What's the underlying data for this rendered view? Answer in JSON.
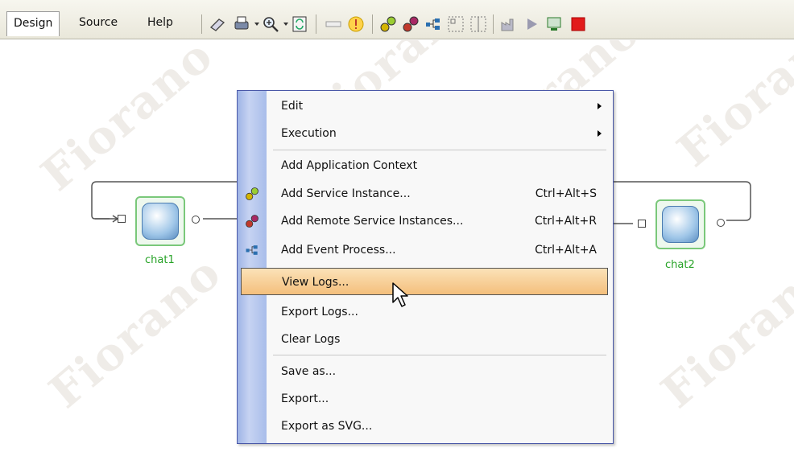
{
  "toolbar": {
    "tabs": [
      "Design",
      "Source",
      "Help"
    ],
    "active_tab": "Design"
  },
  "canvas": {
    "watermark": "Fiorano",
    "nodes": [
      {
        "label": "chat1"
      },
      {
        "label": "chat2"
      }
    ]
  },
  "context_menu": {
    "items": [
      {
        "label": "Edit",
        "submenu": true
      },
      {
        "label": "Execution",
        "submenu": true
      },
      {
        "label": "Add Application Context"
      },
      {
        "label": "Add Service Instance...",
        "shortcut": "Ctrl+Alt+S",
        "icon": "service-instance-icon"
      },
      {
        "label": "Add Remote Service Instances...",
        "shortcut": "Ctrl+Alt+R",
        "icon": "remote-service-icon"
      },
      {
        "label": "Add Event Process...",
        "shortcut": "Ctrl+Alt+A",
        "icon": "event-process-icon"
      },
      {
        "label": "View Logs...",
        "highlighted": true
      },
      {
        "label": "Export Logs..."
      },
      {
        "label": "Clear Logs"
      },
      {
        "label": "Save as..."
      },
      {
        "label": "Export..."
      },
      {
        "label": "Export as SVG..."
      }
    ]
  },
  "colors": {
    "menu_highlight": "#f4bf7c",
    "menu_stripe": "#a9bdea",
    "node_border": "#7ac87a",
    "node_label": "#27a327"
  }
}
